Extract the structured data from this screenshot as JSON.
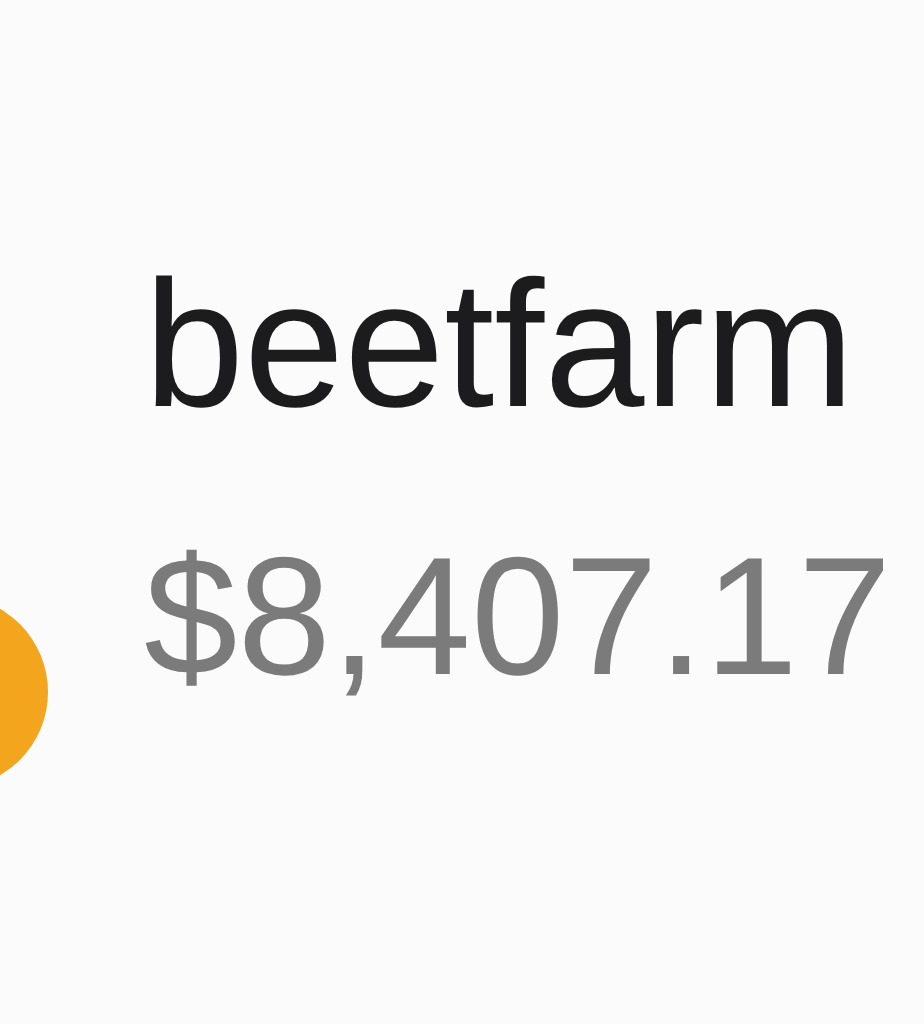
{
  "account": {
    "name": "beetfarm",
    "balance": "$8,407.17"
  }
}
